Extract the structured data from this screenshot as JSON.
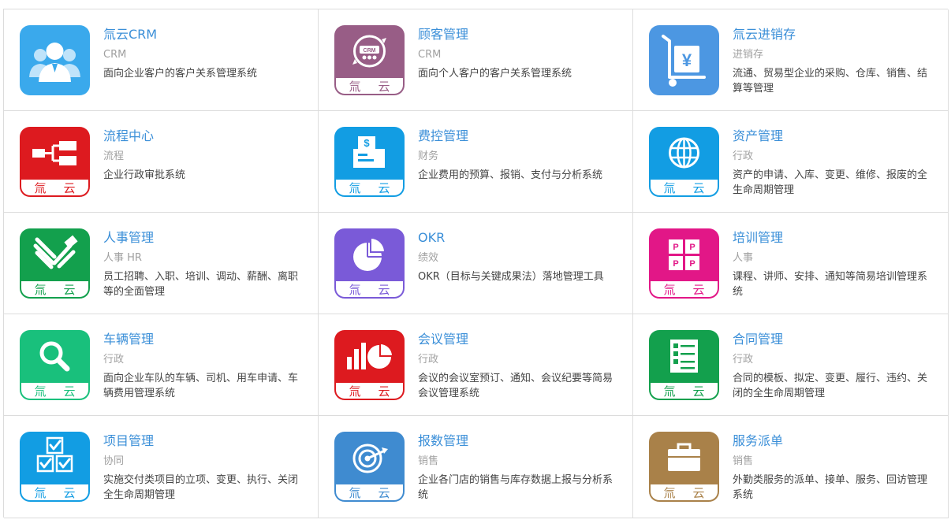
{
  "band_text": {
    "left": "氚",
    "right": "云"
  },
  "cards": [
    {
      "title": "氚云CRM",
      "category": "CRM",
      "desc": "面向企业客户的客户关系管理系统",
      "icon": "people-icon",
      "color": "#3aa9ec",
      "banded": false
    },
    {
      "title": "顾客管理",
      "category": "CRM",
      "desc": "面向个人客户的客户关系管理系统",
      "icon": "crm-cycle-icon",
      "color": "#985d86",
      "banded": true
    },
    {
      "title": "氚云进销存",
      "category": "进销存",
      "desc": "流通、贸易型企业的采购、仓库、销售、结算等管理",
      "icon": "cart-yen-icon",
      "color": "#4c97e2",
      "banded": false
    },
    {
      "title": "流程中心",
      "category": "流程",
      "desc": "企业行政审批系统",
      "icon": "flowchart-icon",
      "color": "#dd1a1f",
      "banded": true
    },
    {
      "title": "费控管理",
      "category": "财务",
      "desc": "企业费用的预算、报销、支付与分析系统",
      "icon": "expense-doc-icon",
      "color": "#129de3",
      "banded": true
    },
    {
      "title": "资产管理",
      "category": "行政",
      "desc": "资产的申请、入库、变更、维修、报废的全生命周期管理",
      "icon": "globe-icon",
      "color": "#129de3",
      "banded": true
    },
    {
      "title": "人事管理",
      "category": "人事 HR",
      "desc": "员工招聘、入职、培训、调动、薪酬、离职等的全面管理",
      "icon": "handshake-icon",
      "color": "#13a04d",
      "banded": true
    },
    {
      "title": "OKR",
      "category": "绩效",
      "desc": "OKR（目标与关键成果法）落地管理工具",
      "icon": "pie-chart-icon",
      "color": "#7a5ad8",
      "banded": true
    },
    {
      "title": "培训管理",
      "category": "人事",
      "desc": "课程、讲师、安排、通知等简易培训管理系统",
      "icon": "puzzle-icon",
      "color": "#e21787",
      "banded": true
    },
    {
      "title": "车辆管理",
      "category": "行政",
      "desc": "面向企业车队的车辆、司机、用车申请、车辆费用管理系统",
      "icon": "magnifier-icon",
      "color": "#19c07c",
      "banded": true
    },
    {
      "title": "会议管理",
      "category": "行政",
      "desc": "会议的会议室预订、通知、会议纪要等简易会议管理系统",
      "icon": "bar-pie-icon",
      "color": "#dd1a1f",
      "banded": true
    },
    {
      "title": "合同管理",
      "category": "行政",
      "desc": "合同的模板、拟定、变更、履行、违约、关闭的全生命周期管理",
      "icon": "checklist-icon",
      "color": "#13a04d",
      "banded": true
    },
    {
      "title": "项目管理",
      "category": "协同",
      "desc": "实施交付类项目的立项、变更、执行、关闭全生命周期管理",
      "icon": "checkbox-blocks-icon",
      "color": "#129de3",
      "banded": true
    },
    {
      "title": "报数管理",
      "category": "销售",
      "desc": "企业各门店的销售与库存数据上报与分析系统",
      "icon": "target-icon",
      "color": "#3f8bd0",
      "banded": true
    },
    {
      "title": "服务派单",
      "category": "销售",
      "desc": "外勤类服务的派单、接单、服务、回访管理系统",
      "icon": "briefcase-icon",
      "color": "#a98149",
      "banded": true
    }
  ]
}
